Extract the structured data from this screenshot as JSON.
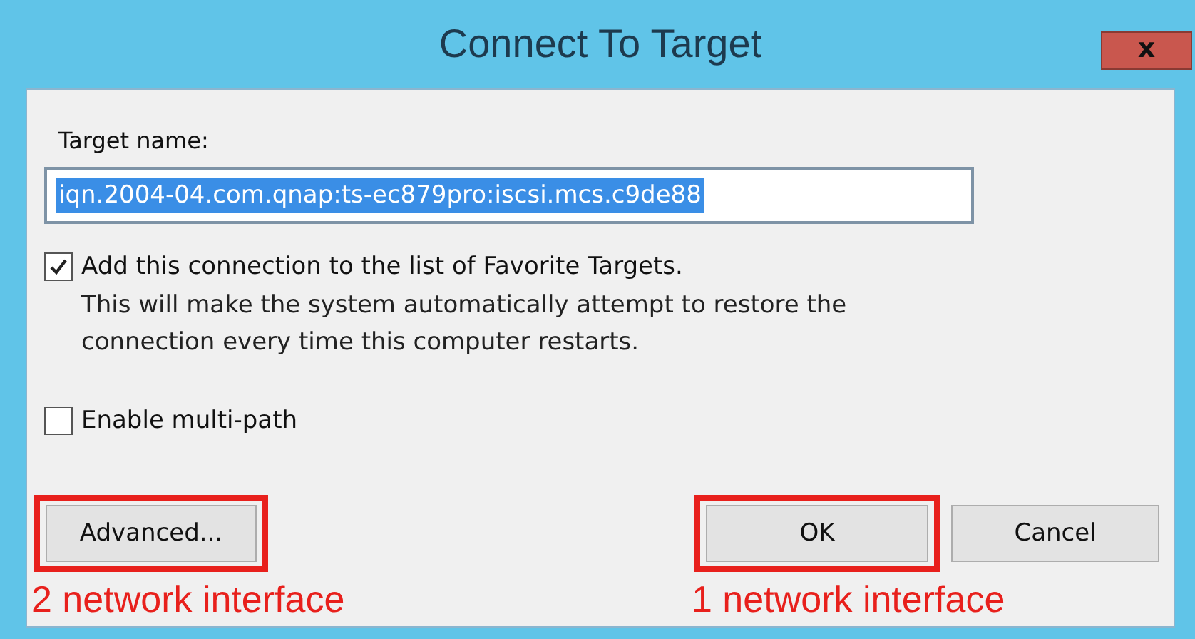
{
  "window": {
    "title": "Connect To Target",
    "close": "x"
  },
  "target_name": {
    "label": "Target name:",
    "value": "iqn.2004-04.com.qnap:ts-ec879pro:iscsi.mcs.c9de88",
    "selected": true
  },
  "options": [
    {
      "label": "Add this connection to the list of Favorite Targets.",
      "description": "This will make the system automatically attempt to restore the connection every time this computer restarts.",
      "checked": true
    },
    {
      "label": "Enable multi-path",
      "checked": false
    }
  ],
  "buttons": [
    {
      "label": "Advanced...",
      "highlighted": true,
      "note": "2 network interface"
    },
    {
      "label": "OK",
      "highlighted": true,
      "note": "1 network interface"
    },
    {
      "label": "Cancel",
      "highlighted": false
    }
  ]
}
